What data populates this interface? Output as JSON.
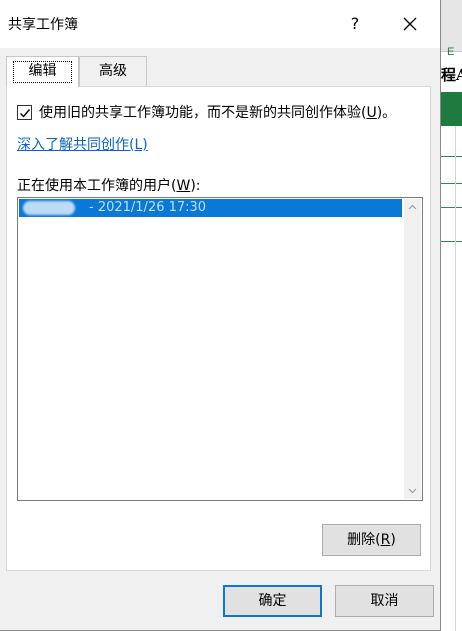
{
  "window": {
    "title": "共享工作簿",
    "help_glyph": "?"
  },
  "tabs": [
    {
      "label": "编辑",
      "active": true
    },
    {
      "label": "高级",
      "active": false
    }
  ],
  "edit_tab": {
    "legacy_sharing": {
      "checked": true,
      "label_before": "使用旧的共享工作簿功能，而不是新的共同创作体验(",
      "mnemonic": "U",
      "label_after": ")。"
    },
    "learn_more_link": "深入了解共同创作(L)",
    "users_label_before": "正在使用本工作簿的用户(",
    "users_label_mnemonic": "W",
    "users_label_after": "):",
    "users": [
      {
        "text": "- 2021/1/26 17:30",
        "selected": true
      }
    ],
    "delete_button": {
      "before": "删除(",
      "mnemonic": "R",
      "after": ")"
    }
  },
  "buttons": {
    "ok": "确定",
    "cancel": "取消"
  },
  "background_sheet": {
    "column_header": "E",
    "title_fragment": "程A"
  },
  "colors": {
    "selection": "#0a78d7",
    "link": "#0a63c8",
    "sheet_green": "#1e7a3e"
  }
}
